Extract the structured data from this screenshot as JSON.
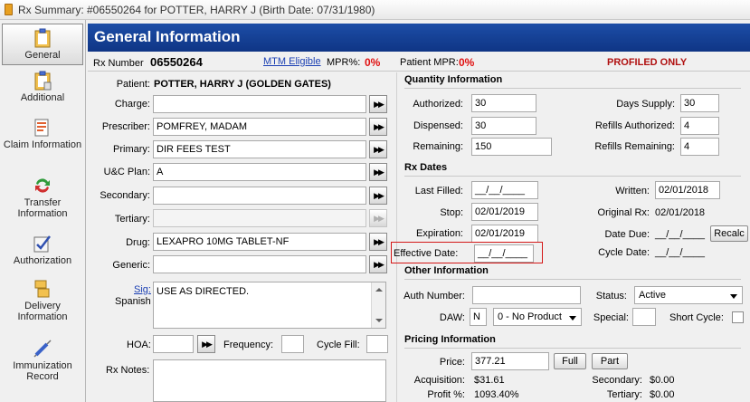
{
  "window": {
    "title": "Rx Summary: #06550264 for POTTER, HARRY J (Birth Date: 07/31/1980)"
  },
  "sidebar": {
    "items": [
      {
        "label": "General"
      },
      {
        "label": "Additional"
      },
      {
        "label": "Claim Information"
      },
      {
        "label": "Transfer Information"
      },
      {
        "label": "Authorization"
      },
      {
        "label": "Delivery Information"
      },
      {
        "label": "Immunization Record"
      }
    ]
  },
  "header": {
    "title": "General Information"
  },
  "info_bar": {
    "rx_number_label": "Rx Number",
    "rx_number": "06550264",
    "mtm_link": "MTM Eligible",
    "mpr_label": "MPR%:",
    "mpr_value": "0%",
    "patient_mpr_label": "Patient MPR:",
    "patient_mpr_value": "0%",
    "status": "PROFILED ONLY"
  },
  "left": {
    "patient_label": "Patient:",
    "patient_value": "POTTER, HARRY J (GOLDEN GATES)",
    "charge_label": "Charge:",
    "charge_value": "",
    "prescriber_label": "Prescriber:",
    "prescriber_value": "POMFREY, MADAM",
    "primary_label": "Primary:",
    "primary_value": "DIR FEES TEST",
    "uc_plan_label": "U&C Plan:",
    "uc_plan_value": "A",
    "secondary_label": "Secondary:",
    "secondary_value": "",
    "tertiary_label": "Tertiary:",
    "tertiary_value": "",
    "drug_label": "Drug:",
    "drug_value": "LEXAPRO 10MG TABLET-NF",
    "generic_label": "Generic:",
    "generic_value": "",
    "sig_link": "Sig:",
    "sig_language": "Spanish",
    "sig_value": "USE AS DIRECTED.",
    "hoa_label": "HOA:",
    "hoa_value": "",
    "frequency_label": "Frequency:",
    "frequency_value": "",
    "cycle_fill_label": "Cycle Fill:",
    "cycle_fill_value": "",
    "rx_notes_label": "Rx Notes:",
    "rx_notes_value": ""
  },
  "quantity": {
    "title": "Quantity Information",
    "authorized_label": "Authorized:",
    "authorized_value": "30",
    "dispensed_label": "Dispensed:",
    "dispensed_value": "30",
    "remaining_label": "Remaining:",
    "remaining_value": "150",
    "days_supply_label": "Days Supply:",
    "days_supply_value": "30",
    "refills_authorized_label": "Refills Authorized:",
    "refills_authorized_value": "4",
    "refills_remaining_label": "Refills Remaining:",
    "refills_remaining_value": "4"
  },
  "rx_dates": {
    "title": "Rx Dates",
    "last_filled_label": "Last Filled:",
    "last_filled_value": "__/__/____",
    "stop_label": "Stop:",
    "stop_value": "02/01/2019",
    "expiration_label": "Expiration:",
    "expiration_value": "02/01/2019",
    "effective_label": "Effective Date:",
    "effective_value": "__/__/____",
    "written_label": "Written:",
    "written_value": "02/01/2018",
    "original_label": "Original Rx:",
    "original_value": "02/01/2018",
    "date_due_label": "Date Due:",
    "date_due_value": "__/__/____",
    "recalc_label": "Recalc",
    "cycle_date_label": "Cycle Date:",
    "cycle_date_value": "__/__/____"
  },
  "other": {
    "title": "Other Information",
    "auth_number_label": "Auth Number:",
    "auth_number_value": "",
    "status_label": "Status:",
    "status_value": "Active",
    "daw_label": "DAW:",
    "daw_code": "N",
    "daw_value": "0 - No Product",
    "special_label": "Special:",
    "special_value": "",
    "short_cycle_label": "Short Cycle:"
  },
  "pricing": {
    "title": "Pricing Information",
    "price_label": "Price:",
    "price_value": "377.21",
    "full_label": "Full",
    "part_label": "Part",
    "acquisition_label": "Acquisition:",
    "acquisition_value": "$31.61",
    "profit_label": "Profit %:",
    "profit_value": "1093.40%",
    "secondary_label": "Secondary:",
    "secondary_value": "$0.00",
    "tertiary_label": "Tertiary:",
    "tertiary_value": "$0.00"
  },
  "colors": {
    "header": "#1c4da6",
    "alert_red": "#e01010",
    "highlight_border": "#d41818",
    "link": "#1a3fb3"
  },
  "icons": [
    "clipboard-icon",
    "clipboard-add-icon",
    "claim-icon",
    "transfer-icon",
    "authorization-icon",
    "delivery-icon",
    "immunization-icon",
    "fast-forward-icon"
  ]
}
